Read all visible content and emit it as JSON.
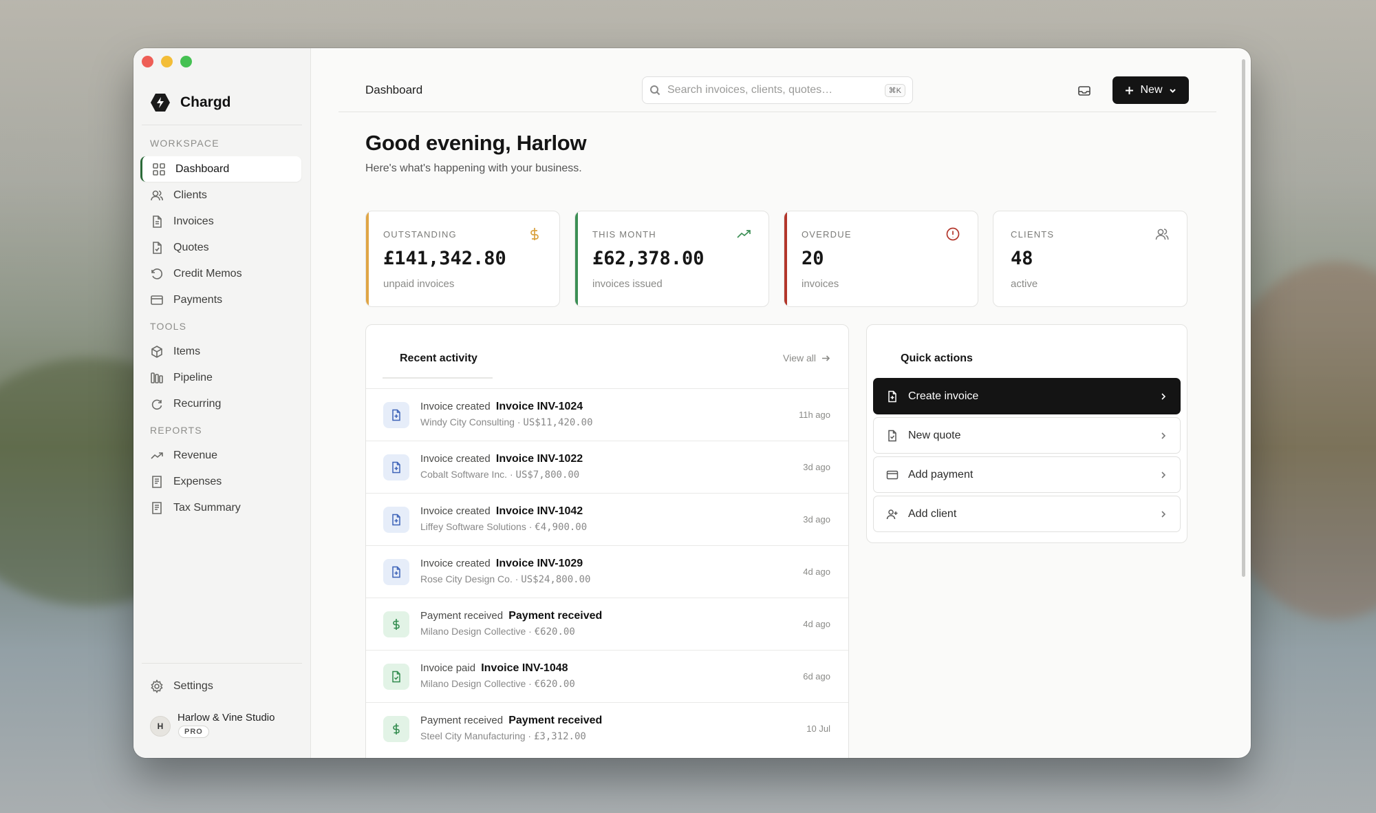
{
  "app": {
    "name": "Chargd"
  },
  "sidebar": {
    "workspace_label": "WORKSPACE",
    "tools_label": "TOOLS",
    "reports_label": "REPORTS",
    "workspace_items": [
      {
        "label": "Dashboard",
        "icon": "grid-icon",
        "active": true
      },
      {
        "label": "Clients",
        "icon": "users-icon"
      },
      {
        "label": "Invoices",
        "icon": "file-icon"
      },
      {
        "label": "Quotes",
        "icon": "file-check-icon"
      },
      {
        "label": "Credit Memos",
        "icon": "rotate-icon"
      },
      {
        "label": "Payments",
        "icon": "card-icon"
      }
    ],
    "tools_items": [
      {
        "label": "Items",
        "icon": "box-icon"
      },
      {
        "label": "Pipeline",
        "icon": "columns-icon"
      },
      {
        "label": "Recurring",
        "icon": "refresh-icon"
      }
    ],
    "reports_items": [
      {
        "label": "Revenue",
        "icon": "trend-icon"
      },
      {
        "label": "Expenses",
        "icon": "receipt-icon"
      },
      {
        "label": "Tax Summary",
        "icon": "receipt-icon"
      }
    ],
    "settings_label": "Settings",
    "org": {
      "initial": "H",
      "name": "Harlow & Vine Studio",
      "badge": "PRO"
    }
  },
  "topbar": {
    "title": "Dashboard",
    "search_placeholder": "Search invoices, clients, quotes…",
    "search_shortcut": "⌘K",
    "new_label": "New"
  },
  "header": {
    "greeting": "Good evening, Harlow",
    "subtitle": "Here's what's happening with your business."
  },
  "stats": [
    {
      "label": "OUTSTANDING",
      "value": "£141,342.80",
      "note": "unpaid invoices",
      "accent": "#e0a545",
      "icon": "dollar-icon"
    },
    {
      "label": "THIS MONTH",
      "value": "£62,378.00",
      "note": "invoices issued",
      "accent": "#3c8f55",
      "icon": "trend-up-icon"
    },
    {
      "label": "OVERDUE",
      "value": "20",
      "note": "invoices",
      "accent": "#b3362b",
      "icon": "alert-icon"
    },
    {
      "label": "CLIENTS",
      "value": "48",
      "note": "active",
      "accent": "",
      "icon": "users-icon"
    }
  ],
  "activity": {
    "title": "Recent activity",
    "view_all": "View all",
    "items": [
      {
        "kind": "Invoice created",
        "title": "Invoice INV-1024",
        "client": "Windy City Consulting",
        "amount": "US$11,420.00",
        "time": "11h ago",
        "tone": "blue",
        "icon": "file-plus-icon"
      },
      {
        "kind": "Invoice created",
        "title": "Invoice INV-1022",
        "client": "Cobalt Software Inc.",
        "amount": "US$7,800.00",
        "time": "3d ago",
        "tone": "blue",
        "icon": "file-plus-icon"
      },
      {
        "kind": "Invoice created",
        "title": "Invoice INV-1042",
        "client": "Liffey Software Solutions",
        "amount": "€4,900.00",
        "time": "3d ago",
        "tone": "blue",
        "icon": "file-plus-icon"
      },
      {
        "kind": "Invoice created",
        "title": "Invoice INV-1029",
        "client": "Rose City Design Co.",
        "amount": "US$24,800.00",
        "time": "4d ago",
        "tone": "blue",
        "icon": "file-plus-icon"
      },
      {
        "kind": "Payment received",
        "title": "Payment received",
        "client": "Milano Design Collective",
        "amount": "€620.00",
        "time": "4d ago",
        "tone": "green",
        "icon": "dollar-icon"
      },
      {
        "kind": "Invoice paid",
        "title": "Invoice INV-1048",
        "client": "Milano Design Collective",
        "amount": "€620.00",
        "time": "6d ago",
        "tone": "green",
        "icon": "file-check-icon"
      },
      {
        "kind": "Payment received",
        "title": "Payment received",
        "client": "Steel City Manufacturing",
        "amount": "£3,312.00",
        "time": "10 Jul",
        "tone": "green",
        "icon": "dollar-icon"
      }
    ]
  },
  "quick_actions": {
    "title": "Quick actions",
    "items": [
      {
        "label": "Create invoice",
        "icon": "file-plus-icon",
        "primary": true
      },
      {
        "label": "New quote",
        "icon": "file-check-icon"
      },
      {
        "label": "Add payment",
        "icon": "card-icon"
      },
      {
        "label": "Add client",
        "icon": "user-plus-icon"
      }
    ]
  }
}
